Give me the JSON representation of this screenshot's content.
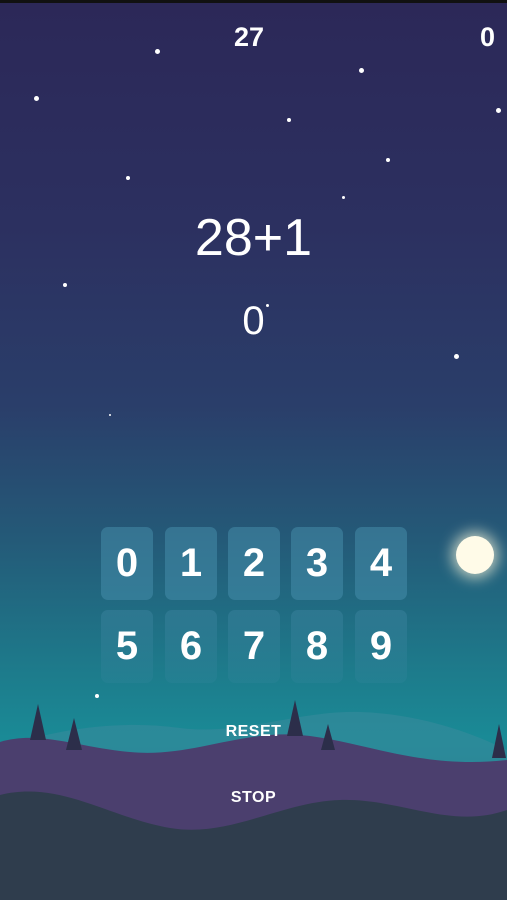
{
  "hud": {
    "timer": "27",
    "score": "0"
  },
  "problem": {
    "expression": "28+1",
    "answer": "0"
  },
  "keypad": {
    "row1": [
      "0",
      "1",
      "2",
      "3",
      "4"
    ],
    "row2": [
      "5",
      "6",
      "7",
      "8",
      "9"
    ]
  },
  "controls": {
    "reset_label": "RESET",
    "stop_label": "STOP"
  },
  "colors": {
    "sky_top": "#2c2858",
    "sky_bottom": "#1a8a96",
    "hills_purple": "#4b3f6e",
    "hills_dark": "#2f3d4d",
    "key_bg": "#468caa"
  }
}
